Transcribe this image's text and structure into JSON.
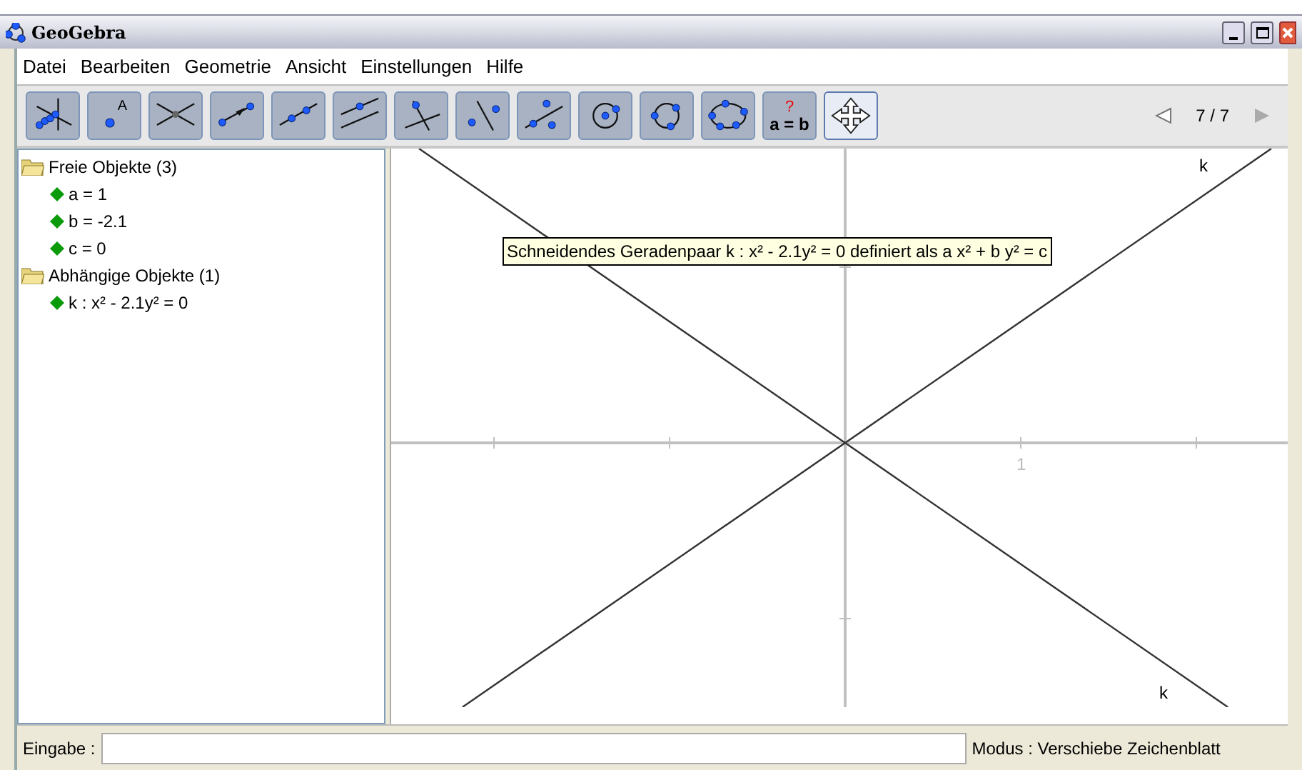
{
  "window": {
    "title": "GeoGebra"
  },
  "menu": [
    "Datei",
    "Bearbeiten",
    "Geometrie",
    "Ansicht",
    "Einstellungen",
    "Hilfe"
  ],
  "toolbar": {
    "tools": [
      {
        "kind": "locus",
        "selected": false
      },
      {
        "kind": "point",
        "label": "A",
        "selected": false
      },
      {
        "kind": "intersect",
        "selected": false
      },
      {
        "kind": "vector",
        "selected": false
      },
      {
        "kind": "line",
        "selected": false
      },
      {
        "kind": "parallel",
        "selected": false
      },
      {
        "kind": "perpendicular",
        "selected": false
      },
      {
        "kind": "point-line",
        "selected": false
      },
      {
        "kind": "three-points",
        "selected": false
      },
      {
        "kind": "circle",
        "selected": false
      },
      {
        "kind": "circle3",
        "selected": false
      },
      {
        "kind": "conic",
        "selected": false
      },
      {
        "kind": "relation",
        "label": "a = b",
        "mark": "?",
        "selected": false
      },
      {
        "kind": "move",
        "selected": true
      }
    ],
    "page": "7 / 7"
  },
  "algebra": [
    {
      "label": "Freie Objekte (3)",
      "expanded": true,
      "children": [
        {
          "label": "a = 1"
        },
        {
          "label": "b = -2.1"
        },
        {
          "label": "c = 0"
        }
      ]
    },
    {
      "label": "Abhängige Objekte (1)",
      "expanded": true,
      "children": [
        {
          "label": "k : x² - 2.1y² = 0"
        }
      ]
    }
  ],
  "graphics": {
    "x_tick_label": "1",
    "curve_labels": [
      "k",
      "k"
    ],
    "tooltip": "Schneidendes Geradenpaar k : x² - 2.1y² = 0 definiert als a x² + b y² = c"
  },
  "input": {
    "label": "Eingabe :"
  },
  "status": "Modus : Verschiebe Zeichenblatt"
}
